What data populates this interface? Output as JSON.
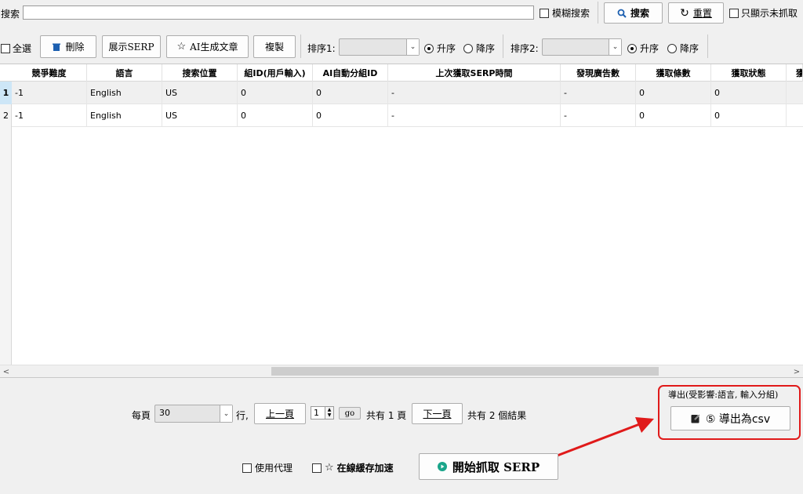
{
  "search": {
    "label": "搜索",
    "value": "",
    "fuzzy_label": "模糊搜索",
    "search_btn": "搜索",
    "reset_btn": "重置",
    "unfetched_label": "只顯示未抓取"
  },
  "toolbar": {
    "select_all": "全選",
    "delete": "刪除",
    "show_serp": "展示SERP",
    "ai_article": "AI生成文章",
    "copy": "複製",
    "sort1_label": "排序1:",
    "sort2_label": "排序2:",
    "asc": "升序",
    "desc": "降序"
  },
  "table": {
    "columns": [
      "競爭難度",
      "語言",
      "搜索位置",
      "組ID(用戶輸入)",
      "AI自動分組ID",
      "上次獲取SERP時間",
      "發現廣告數",
      "獲取條數",
      "獲取狀態",
      "獲"
    ],
    "rows": [
      {
        "num": "1",
        "cells": [
          "-1",
          "English",
          "US",
          "0",
          "0",
          "-",
          "-",
          "0",
          "0"
        ]
      },
      {
        "num": "2",
        "cells": [
          "-1",
          "English",
          "US",
          "0",
          "0",
          "-",
          "-",
          "0",
          "0"
        ]
      }
    ]
  },
  "pagination": {
    "per_page_label": "每頁",
    "per_page_value": "30",
    "rows_suffix": "行,",
    "prev": "上一頁",
    "page_value": "1",
    "go": "go",
    "total_pages": "共有 1 頁",
    "next": "下一頁",
    "total_results": "共有 2 個結果"
  },
  "export": {
    "caption": "導出(受影響:語言, 輸入分組)",
    "button": "⑤ 導出為csv"
  },
  "bottom": {
    "proxy": "使用代理",
    "cache": "在線緩存加速",
    "start": "開始抓取 SERP"
  },
  "colors": {
    "annotation_red": "#e01a1a",
    "selected_row": "#cde6f7",
    "start_icon": "#1aa58a"
  }
}
